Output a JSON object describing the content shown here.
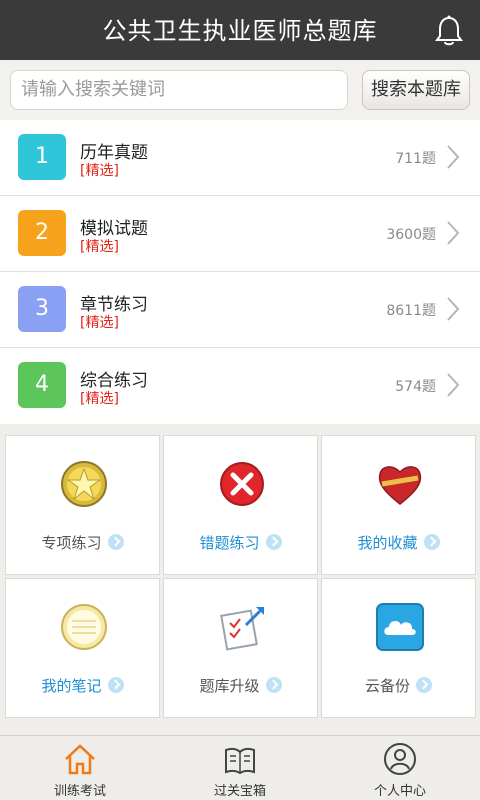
{
  "header": {
    "title": "公共卫生执业医师总题库",
    "bell_icon": "bell-icon"
  },
  "search": {
    "placeholder": "请输入搜索关键词",
    "button_label": "搜索本题库"
  },
  "categories": [
    {
      "num": "1",
      "name": "历年真题",
      "tag": "[精选]",
      "count": "711题",
      "color": "#2fc6d9"
    },
    {
      "num": "2",
      "name": "模拟试题",
      "tag": "[精选]",
      "count": "3600题",
      "color": "#f7a21b"
    },
    {
      "num": "3",
      "name": "章节练习",
      "tag": "[精选]",
      "count": "8611题",
      "color": "#8aa0f4"
    },
    {
      "num": "4",
      "name": "综合练习",
      "tag": "[精选]",
      "count": "574题",
      "color": "#5cc65b"
    }
  ],
  "features": [
    {
      "label": "专项练习",
      "icon": "star-badge-icon"
    },
    {
      "label": "错题练习",
      "icon": "error-x-icon"
    },
    {
      "label": "我的收藏",
      "icon": "heart-icon"
    },
    {
      "label": "我的笔记",
      "icon": "notepad-icon"
    },
    {
      "label": "题库升级",
      "icon": "upgrade-checklist-icon"
    },
    {
      "label": "云备份",
      "icon": "cloud-icon"
    }
  ],
  "tabs": [
    {
      "label": "训练考试",
      "icon": "home-icon"
    },
    {
      "label": "过关宝箱",
      "icon": "book-icon"
    },
    {
      "label": "个人中心",
      "icon": "user-icon"
    }
  ]
}
